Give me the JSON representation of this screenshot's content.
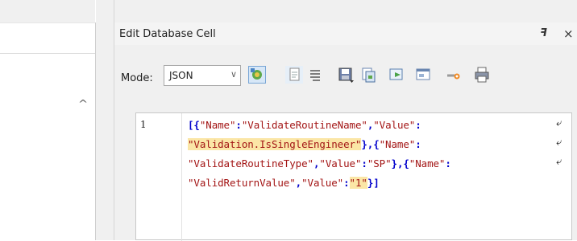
{
  "panel": {
    "title": "Edit Database Cell"
  },
  "toolbar": {
    "mode_label": "Mode:",
    "mode_value": "JSON"
  },
  "editor": {
    "line_number": "1",
    "tokens": {
      "t1": "[{",
      "t2": "\"Name\"",
      "t3": ":",
      "t4": "\"ValidateRoutineName\"",
      "t5": ",",
      "t6": "\"Value\"",
      "t7": ":",
      "t8": "\"Validation.IsSingleEngineer\"",
      "t9": "},{",
      "t10": "\"Name\"",
      "t11": ":",
      "t12": "\"ValidateRoutineType\"",
      "t13": ",",
      "t14": "\"Value\"",
      "t15": ":",
      "t16": "\"SP\"",
      "t17": "},{",
      "t18": "\"Name\"",
      "t19": ":",
      "t20": "\"ValidReturnValue\"",
      "t21": ",",
      "t22": "\"Value\"",
      "t23": ":",
      "t24": "\"1\"",
      "t25": "}]"
    },
    "wrap_glyph": "⤶"
  }
}
